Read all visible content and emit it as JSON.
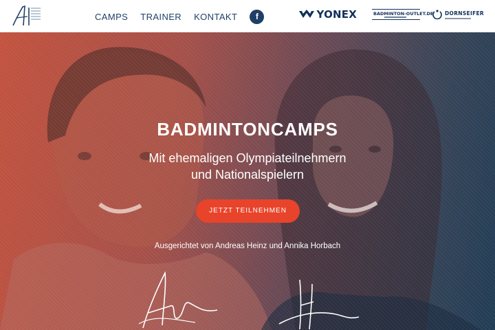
{
  "header": {
    "logo_icon": "ah-monogram-logo",
    "nav": {
      "camps": "CAMPS",
      "trainer": "TRAINER",
      "kontakt": "KONTAKT",
      "facebook_icon": "facebook-icon",
      "facebook_glyph": "f"
    },
    "sponsors": {
      "yonex": "YONEX",
      "badminton_outlet": "BADMINTON-OUTLET.DE",
      "dornseifer": "DORNSEIFER"
    }
  },
  "hero": {
    "title": "BADMINTONCAMPS",
    "subtitle_line1": "Mit ehemaligen Olympiateilnehmern",
    "subtitle_line2": "und Nationalspielern",
    "cta_label": "JETZT TEILNEHMEN",
    "hosted_by": "Ausgerichtet von Andreas Heinz und Annika Horbach"
  },
  "colors": {
    "nav_text": "#1f3f66",
    "cta_bg": "#e8442b",
    "gradient_left": "#c2533f",
    "gradient_right": "#213d56"
  }
}
